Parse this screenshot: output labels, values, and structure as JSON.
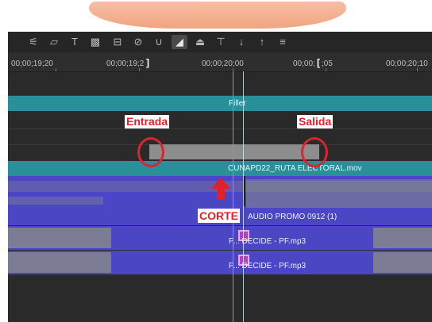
{
  "toolbar": {
    "icons": [
      "sliders-icon",
      "eraser-icon",
      "text-tool-icon",
      "film-icon",
      "speed-icon",
      "disable-icon",
      "ripple-icon",
      "volume-icon",
      "snap-icon",
      "marker-icon",
      "arrow-down-icon",
      "arrow-up-icon",
      "align-icon"
    ]
  },
  "ruler": {
    "timecodes": [
      "00;00;19;20",
      "00;00;19;2",
      "00;00;20;00",
      "00;00;",
      ";05",
      "00;00;20;10"
    ]
  },
  "tracks": {
    "filler_label": "Filler",
    "video_clip_label": "CUNAPD22_RUTA ELECTORAL.mov",
    "audio_main_label": "AUDIO PROMO 0912 (1)",
    "audio_clip1_label": "P... DECIDE - PF.mp3",
    "audio_clip2_label": "P... DECIDE - PF.mp3"
  },
  "annotations": {
    "in_label": "Entrada",
    "out_label": "Salida",
    "cut_label": "CORTE"
  },
  "colors": {
    "teal_track": "#2a8f99",
    "audio_purple": "#4b46c4",
    "annotation_red": "#e0202a",
    "playhead": "#3fb6d8"
  }
}
